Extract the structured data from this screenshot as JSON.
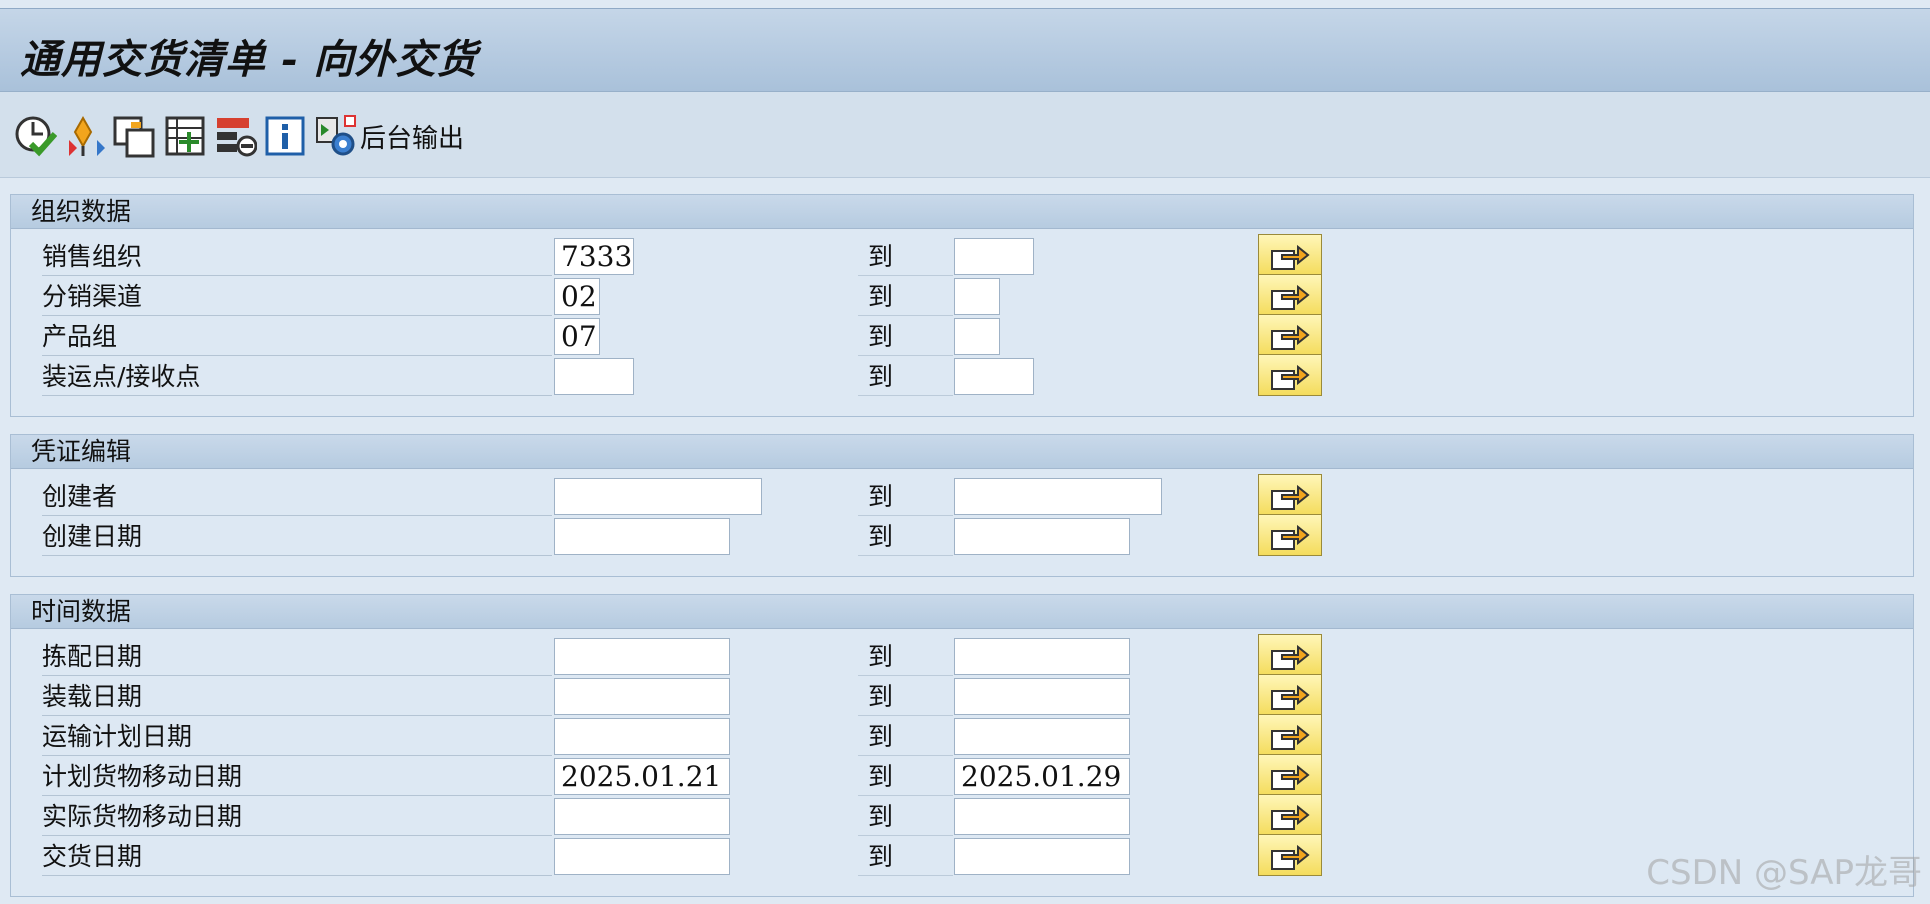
{
  "title": "通用交货清单 - 向外交货",
  "toolbar": {
    "icons": [
      "execute-icon",
      "get-variant-icon",
      "copy-icon",
      "multiple-selection-icon",
      "delete-selection-icon",
      "info-icon",
      "background-job-icon"
    ],
    "background_label": "后台输出"
  },
  "groups": [
    {
      "title": "组织数据",
      "rows": [
        {
          "label": "销售组织",
          "from": "7333",
          "to_label": "到",
          "to": ""
        },
        {
          "label": "分销渠道",
          "from": "02",
          "to_label": "到",
          "to": ""
        },
        {
          "label": "产品组",
          "from": "07",
          "to_label": "到",
          "to": ""
        },
        {
          "label": "装运点/接收点",
          "from": "",
          "to_label": "到",
          "to": ""
        }
      ]
    },
    {
      "title": "凭证编辑",
      "rows": [
        {
          "label": "创建者",
          "from": "",
          "to_label": "到",
          "to": ""
        },
        {
          "label": "创建日期",
          "from": "",
          "to_label": "到",
          "to": ""
        }
      ]
    },
    {
      "title": "时间数据",
      "rows": [
        {
          "label": "拣配日期",
          "from": "",
          "to_label": "到",
          "to": ""
        },
        {
          "label": "装载日期",
          "from": "",
          "to_label": "到",
          "to": ""
        },
        {
          "label": "运输计划日期",
          "from": "",
          "to_label": "到",
          "to": ""
        },
        {
          "label": "计划货物移动日期",
          "from": "2025.01.21",
          "to_label": "到",
          "to": "2025.01.29"
        },
        {
          "label": "实际货物移动日期",
          "from": "",
          "to_label": "到",
          "to": ""
        },
        {
          "label": "交货日期",
          "from": "",
          "to_label": "到",
          "to": ""
        }
      ]
    }
  ],
  "watermark": "CSDN @SAP龙哥"
}
